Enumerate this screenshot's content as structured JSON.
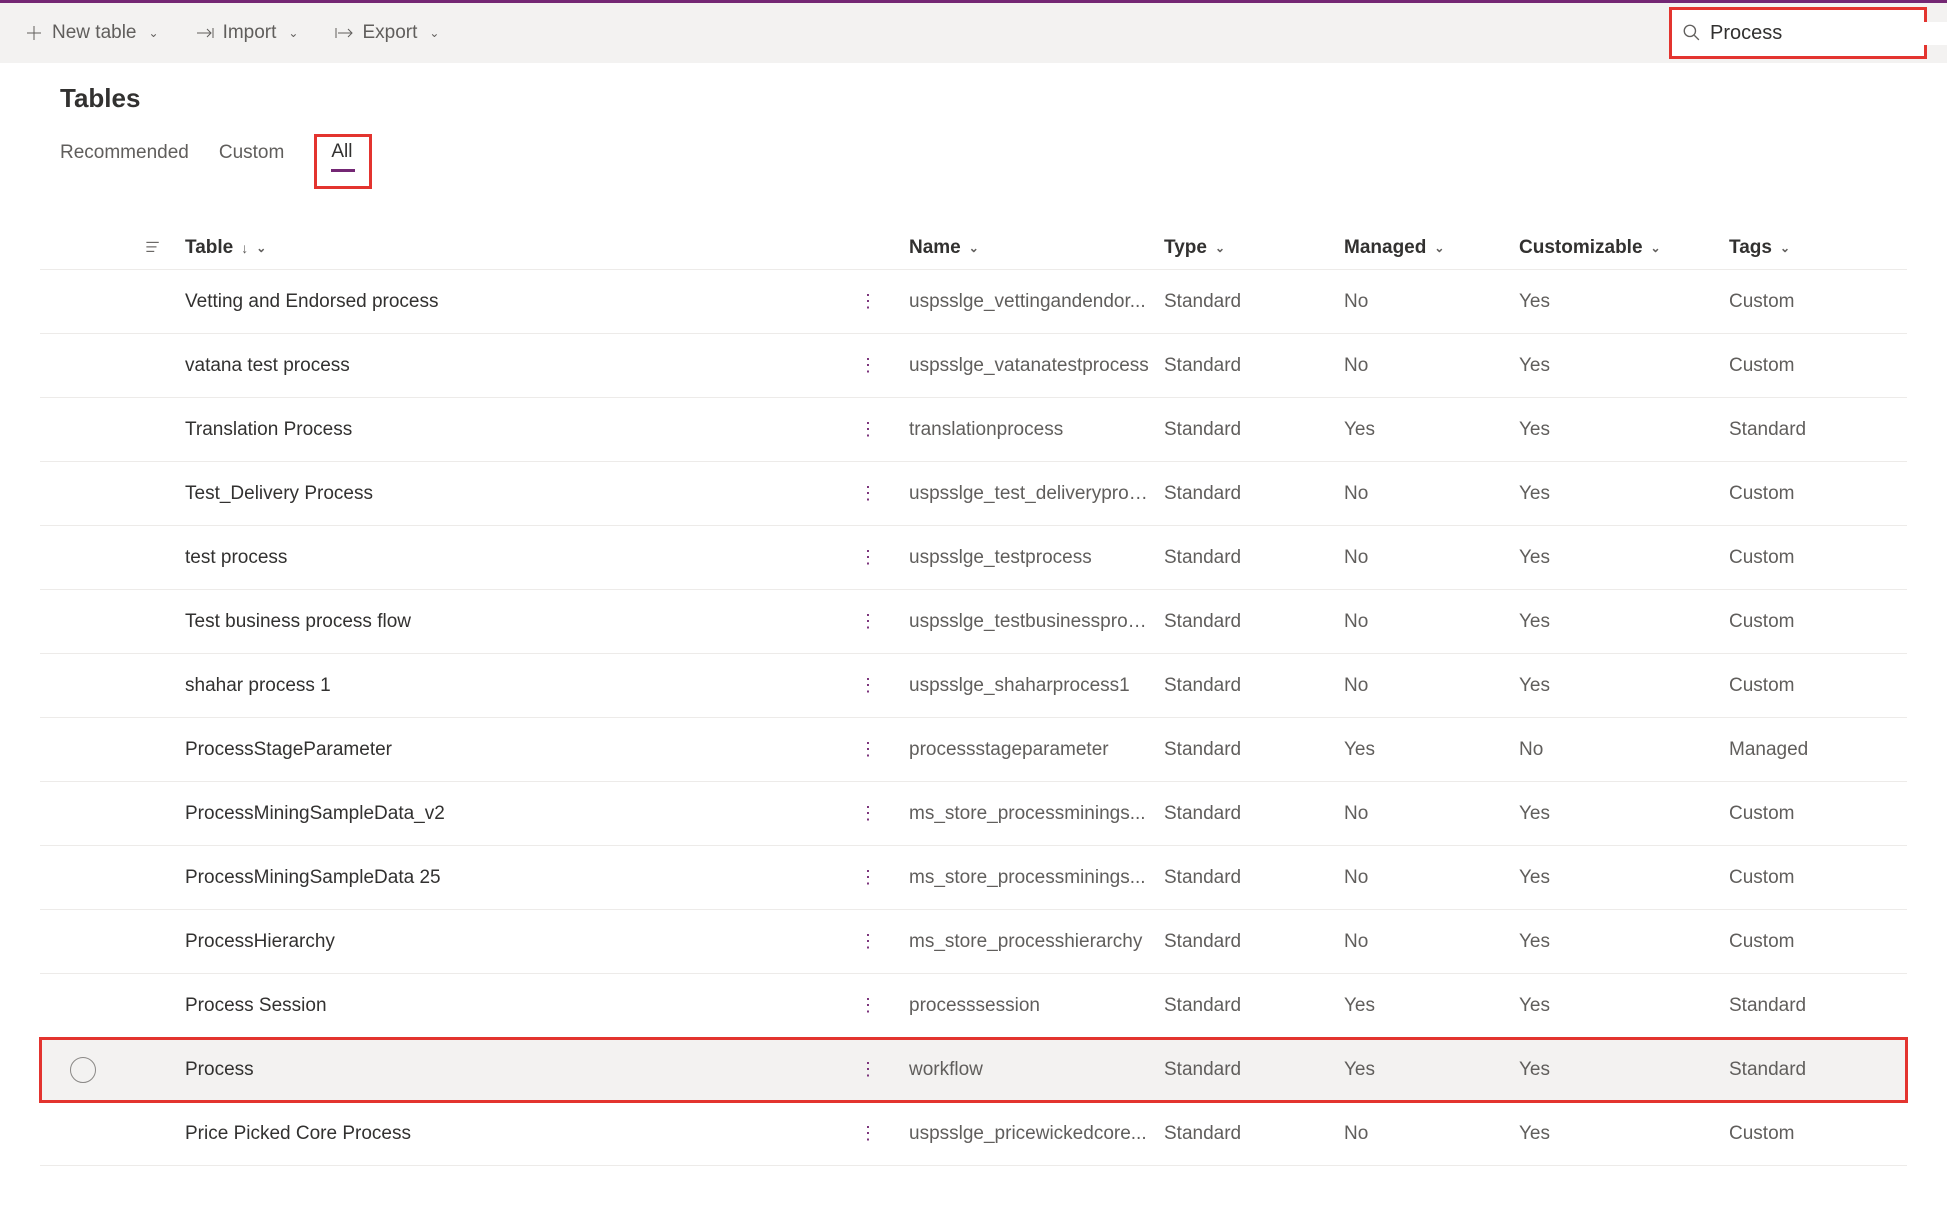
{
  "toolbar": {
    "new_table": "New table",
    "import": "Import",
    "export": "Export"
  },
  "search": {
    "value": "Process"
  },
  "page": {
    "title": "Tables"
  },
  "tabs": {
    "recommended": "Recommended",
    "custom": "Custom",
    "all": "All"
  },
  "columns": {
    "table": "Table",
    "name": "Name",
    "type": "Type",
    "managed": "Managed",
    "customizable": "Customizable",
    "tags": "Tags"
  },
  "rows": [
    {
      "table": "Vetting and Endorsed process",
      "name": "uspsslge_vettingandendor...",
      "type": "Standard",
      "managed": "No",
      "customizable": "Yes",
      "tags": "Custom"
    },
    {
      "table": "vatana test process",
      "name": "uspsslge_vatanatestprocess",
      "type": "Standard",
      "managed": "No",
      "customizable": "Yes",
      "tags": "Custom"
    },
    {
      "table": "Translation Process",
      "name": "translationprocess",
      "type": "Standard",
      "managed": "Yes",
      "customizable": "Yes",
      "tags": "Standard"
    },
    {
      "table": "Test_Delivery Process",
      "name": "uspsslge_test_deliveryproc...",
      "type": "Standard",
      "managed": "No",
      "customizable": "Yes",
      "tags": "Custom"
    },
    {
      "table": "test process",
      "name": "uspsslge_testprocess",
      "type": "Standard",
      "managed": "No",
      "customizable": "Yes",
      "tags": "Custom"
    },
    {
      "table": "Test business process flow",
      "name": "uspsslge_testbusinessproc...",
      "type": "Standard",
      "managed": "No",
      "customizable": "Yes",
      "tags": "Custom"
    },
    {
      "table": "shahar process 1",
      "name": "uspsslge_shaharprocess1",
      "type": "Standard",
      "managed": "No",
      "customizable": "Yes",
      "tags": "Custom"
    },
    {
      "table": "ProcessStageParameter",
      "name": "processstageparameter",
      "type": "Standard",
      "managed": "Yes",
      "customizable": "No",
      "tags": "Managed"
    },
    {
      "table": "ProcessMiningSampleData_v2",
      "name": "ms_store_processminings...",
      "type": "Standard",
      "managed": "No",
      "customizable": "Yes",
      "tags": "Custom"
    },
    {
      "table": "ProcessMiningSampleData 25",
      "name": "ms_store_processminings...",
      "type": "Standard",
      "managed": "No",
      "customizable": "Yes",
      "tags": "Custom"
    },
    {
      "table": "ProcessHierarchy",
      "name": "ms_store_processhierarchy",
      "type": "Standard",
      "managed": "No",
      "customizable": "Yes",
      "tags": "Custom"
    },
    {
      "table": "Process Session",
      "name": "processsession",
      "type": "Standard",
      "managed": "Yes",
      "customizable": "Yes",
      "tags": "Standard"
    },
    {
      "table": "Process",
      "name": "workflow",
      "type": "Standard",
      "managed": "Yes",
      "customizable": "Yes",
      "tags": "Standard",
      "highlight": true
    },
    {
      "table": "Price Picked Core Process",
      "name": "uspsslge_pricewickedcore...",
      "type": "Standard",
      "managed": "No",
      "customizable": "Yes",
      "tags": "Custom"
    }
  ]
}
